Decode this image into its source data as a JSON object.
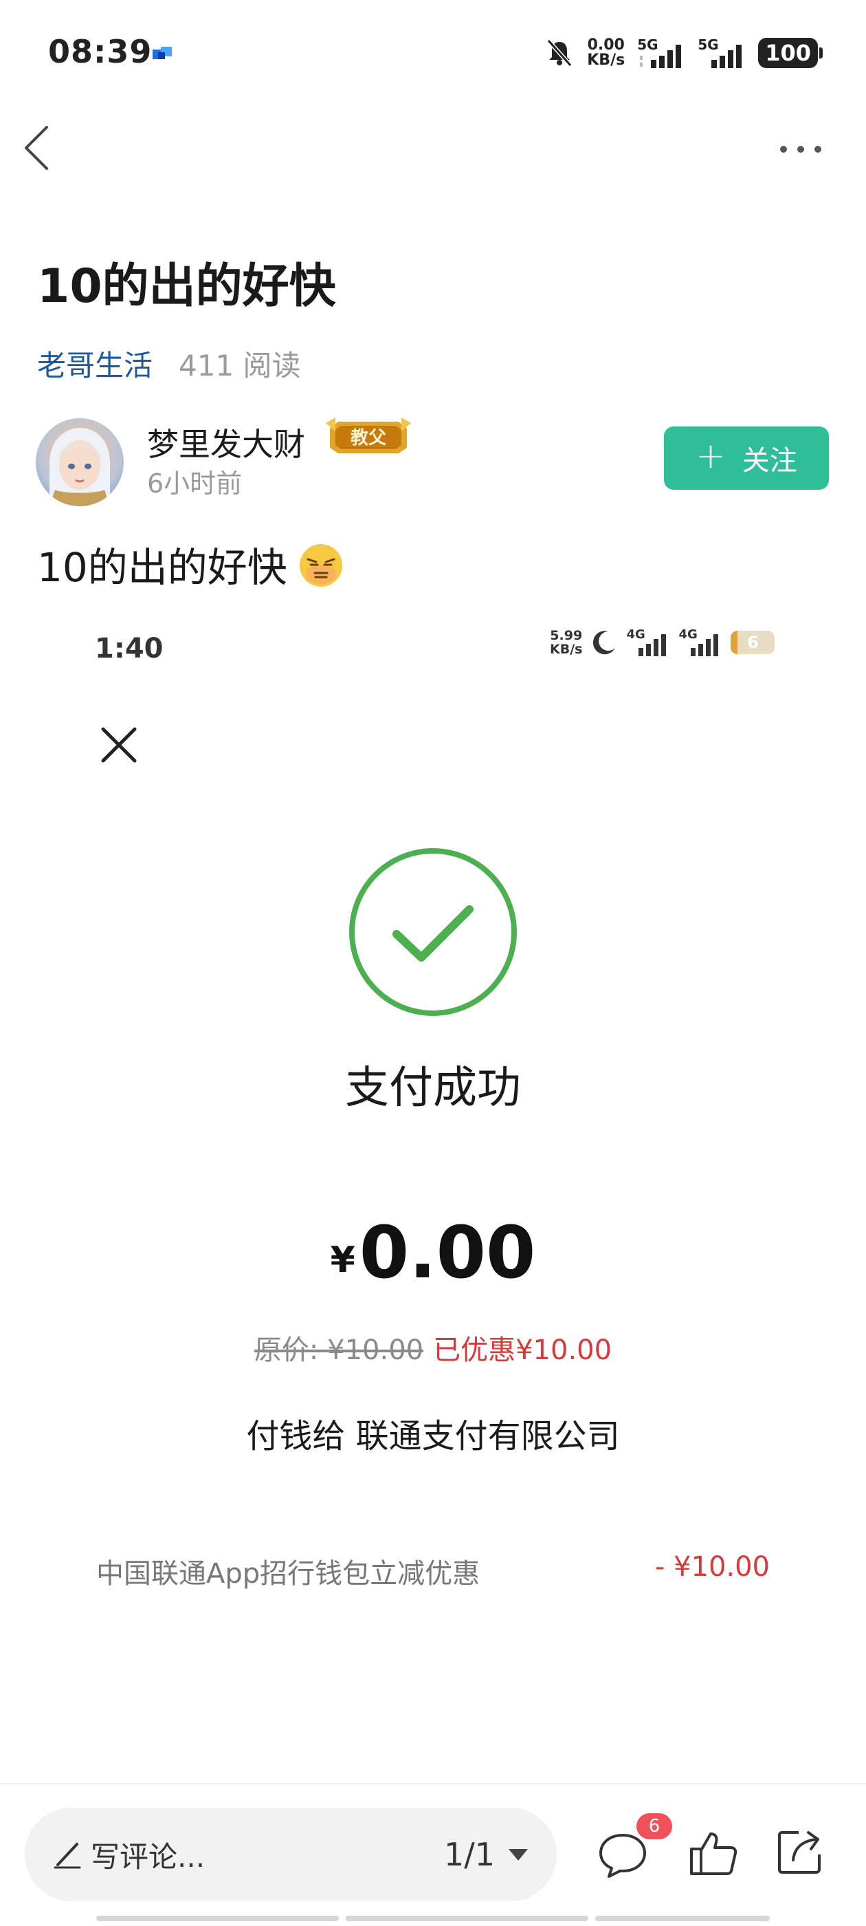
{
  "status_bar": {
    "time": "08:39",
    "speed_value": "0.00",
    "speed_unit": "KB/s",
    "signal_1": "5G",
    "signal_2": "5G",
    "battery": "100"
  },
  "post": {
    "title": "10的出的好快",
    "circle": "老哥生活",
    "reads": "411 阅读",
    "author": {
      "name": "梦里发大财",
      "badge": "教父",
      "time": "6小时前"
    },
    "follow_label": "关注",
    "body": "10的出的好快",
    "body_emoji": "grimace-emoji"
  },
  "screenshot": {
    "time": "1:40",
    "speed_value": "5.99",
    "speed_unit": "KB/s",
    "signal_1": "4G",
    "signal_2": "4G",
    "battery": "6",
    "success_text": "支付成功",
    "currency": "¥",
    "amount": "0.00",
    "original_price": "原价: ¥10.00",
    "discount": "已优惠¥10.00",
    "payee": "付钱给 联通支付有限公司",
    "promo_label": "中国联通App招行钱包立减优惠",
    "promo_amount": "- ¥10.00"
  },
  "bottom_bar": {
    "comment_placeholder": "写评论...",
    "page_indicator": "1/1",
    "comment_count": "6"
  },
  "colors": {
    "accent_green": "#2ebf9a",
    "link_blue": "#1d5a9a",
    "success_green": "#4caf50",
    "discount_red": "#d63a3a"
  }
}
